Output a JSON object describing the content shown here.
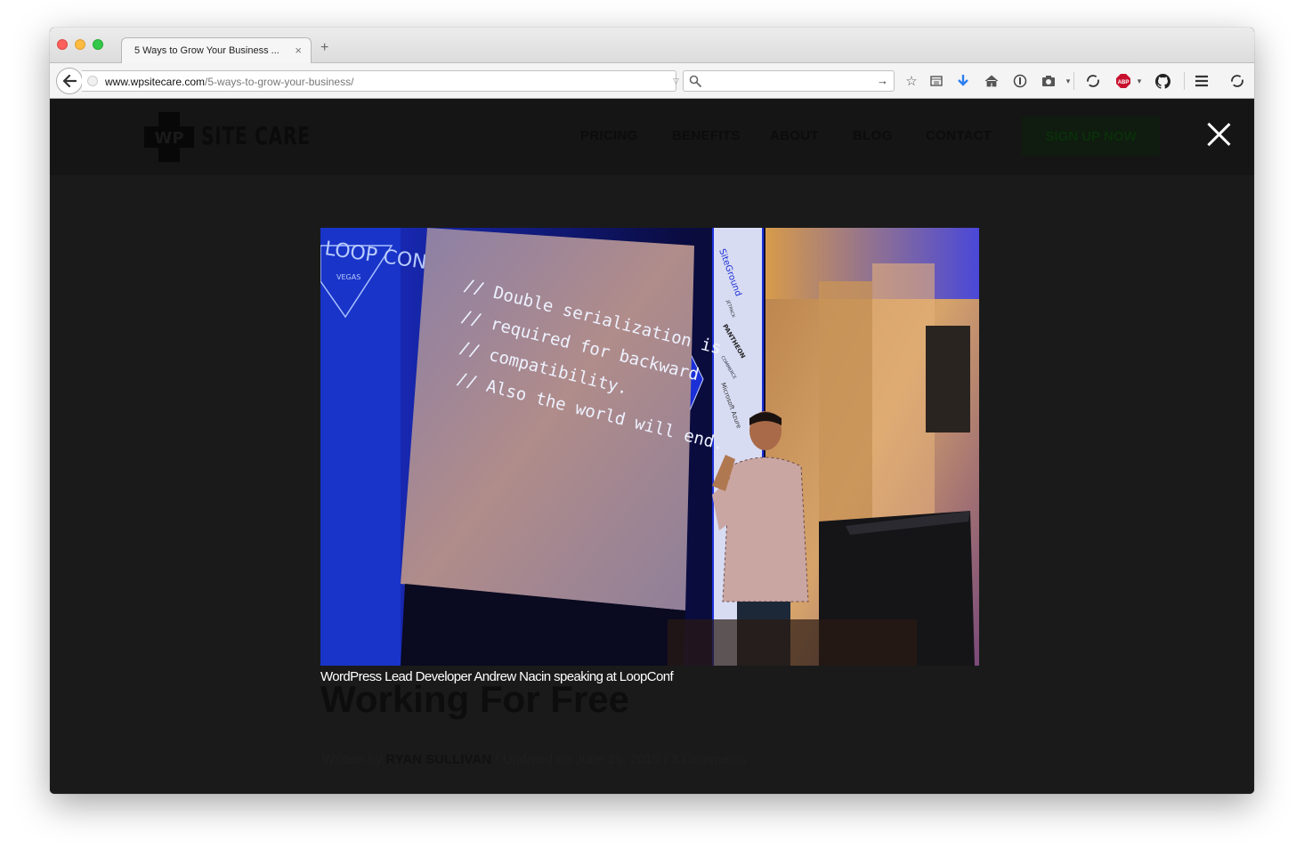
{
  "browser": {
    "tab": {
      "title": "5 Ways to Grow Your Business ...",
      "close_glyph": "×"
    },
    "new_tab_glyph": "+",
    "url": {
      "host": "www.wpsitecare.com",
      "path": "/5-ways-to-grow-your-business/"
    },
    "search": {
      "placeholder": ""
    },
    "toolbar_icons": [
      "star-icon",
      "reading-list-icon",
      "download-icon",
      "home-icon",
      "info-icon",
      "screenshot-icon",
      "sync-icon",
      "adblock-icon",
      "github-icon",
      "menu-icon",
      "sync-icon"
    ],
    "adblock_label": "ABP"
  },
  "site": {
    "logo": {
      "mark": "WP",
      "text": "SITE CARE"
    },
    "nav": [
      "PRICING",
      "BENEFITS",
      "ABOUT",
      "BLOG",
      "CONTACT"
    ],
    "signup_label": "SIGN UP NOW",
    "accent_color": "#2e8b2e"
  },
  "lightbox": {
    "slide_lines": [
      "// Double serialization is",
      "// required for backward",
      "// compatibility.",
      "// Also the world will end."
    ],
    "banner_text": "LOOP CONF",
    "banner_sub": "VEGAS",
    "sponsors": [
      "SiteGround",
      "JETPACK",
      "PANTHEON",
      "COMMERCE",
      "Microsoft Azure"
    ],
    "caption": "WordPress Lead Developer Andrew Nacin speaking at LoopConf"
  },
  "article": {
    "title": "Working For Free",
    "meta": {
      "written_by": "Written by",
      "author": "RYAN SULLIVAN",
      "sep1": "/",
      "updated": "Updated on June 29, 2015",
      "sep2": "/",
      "comments": "3 Comments"
    }
  }
}
